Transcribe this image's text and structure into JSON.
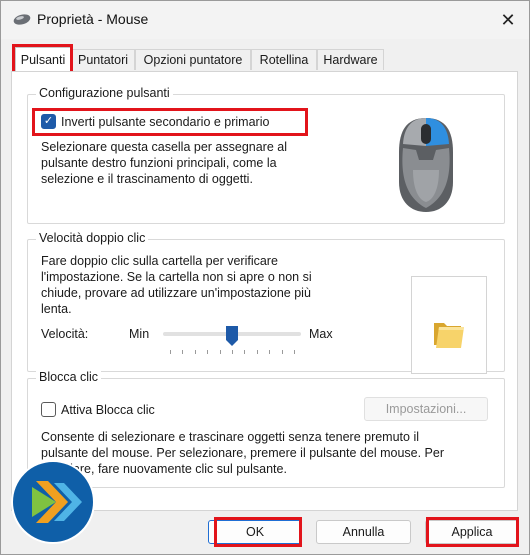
{
  "window": {
    "title": "Proprietà - Mouse",
    "close_glyph": "✕"
  },
  "tabs": [
    {
      "label": "Pulsanti"
    },
    {
      "label": "Puntatori"
    },
    {
      "label": "Opzioni puntatore"
    },
    {
      "label": "Rotellina"
    },
    {
      "label": "Hardware"
    }
  ],
  "config": {
    "title": "Configurazione pulsanti",
    "checkbox_label": "Inverti pulsante secondario e primario",
    "checked": true,
    "description": [
      "Selezionare questa casella per assegnare al",
      "pulsante destro funzioni principali, come la",
      "selezione e il trascinamento di oggetti."
    ]
  },
  "double_click": {
    "title": "Velocità doppio clic",
    "description": [
      "Fare doppio clic sulla cartella per verificare",
      "l'impostazione. Se la cartella non si apre o non si",
      "chiude, provare ad utilizzare un'impostazione più",
      "lenta."
    ],
    "speed_label": "Velocità:",
    "min_label": "Min",
    "max_label": "Max",
    "slider_level": 0.5
  },
  "click_lock": {
    "title": "Blocca clic",
    "checkbox_label": "Attiva Blocca clic",
    "checked": false,
    "settings_button": "Impostazioni...",
    "description": [
      "Consente di selezionare e trascinare oggetti senza tenere premuto il",
      "pulsante del mouse. Per selezionare, premere il pulsante del mouse. Per",
      "rilasciare, fare nuovamente clic sul pulsante."
    ]
  },
  "buttons": {
    "ok": "OK",
    "cancel": "Annulla",
    "apply": "Applica"
  },
  "colors": {
    "highlight": "#e2141b",
    "accent": "#1e5aa8",
    "mouse_button_blue": "#2f8fe0"
  }
}
